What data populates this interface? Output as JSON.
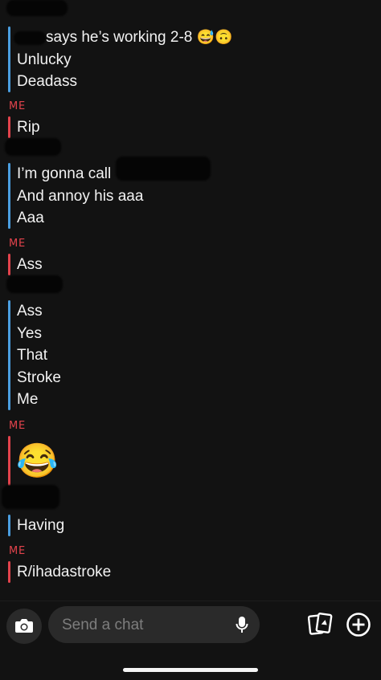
{
  "conversation": [
    {
      "sender": "",
      "side": "friend",
      "messages": [
        {
          "text": "says he’s working 2-8",
          "emoji": "😅🙃"
        },
        {
          "text": "Unlucky"
        },
        {
          "text": "Deadass"
        }
      ]
    },
    {
      "sender": "ME",
      "side": "me",
      "messages": [
        {
          "text": "Rip"
        }
      ]
    },
    {
      "sender": "",
      "side": "friend",
      "messages": [
        {
          "text": "I’m gonna call"
        },
        {
          "text": "And annoy his aaa"
        },
        {
          "text": "Aaa"
        }
      ]
    },
    {
      "sender": "ME",
      "side": "me",
      "messages": [
        {
          "text": "Ass"
        }
      ]
    },
    {
      "sender": "",
      "side": "friend",
      "messages": [
        {
          "text": "Ass"
        },
        {
          "text": "Yes"
        },
        {
          "text": "That"
        },
        {
          "text": "Stroke"
        },
        {
          "text": "Me"
        }
      ]
    },
    {
      "sender": "ME",
      "side": "me",
      "messages": [
        {
          "emoji_only": "😂"
        }
      ]
    },
    {
      "sender": "",
      "side": "friend",
      "messages": [
        {
          "text": "Having"
        }
      ]
    },
    {
      "sender": "ME",
      "side": "me",
      "messages": [
        {
          "text": "R/ihadastroke"
        }
      ]
    }
  ],
  "composer": {
    "placeholder": "Send a chat",
    "camera_icon": "camera-icon",
    "mic_icon": "microphone-icon",
    "cards_icon": "cards-icon",
    "plus_icon": "plus-circle-icon"
  },
  "colors": {
    "background": "#121212",
    "me_accent": "#e2434c",
    "friend_accent": "#4a9ee0"
  }
}
